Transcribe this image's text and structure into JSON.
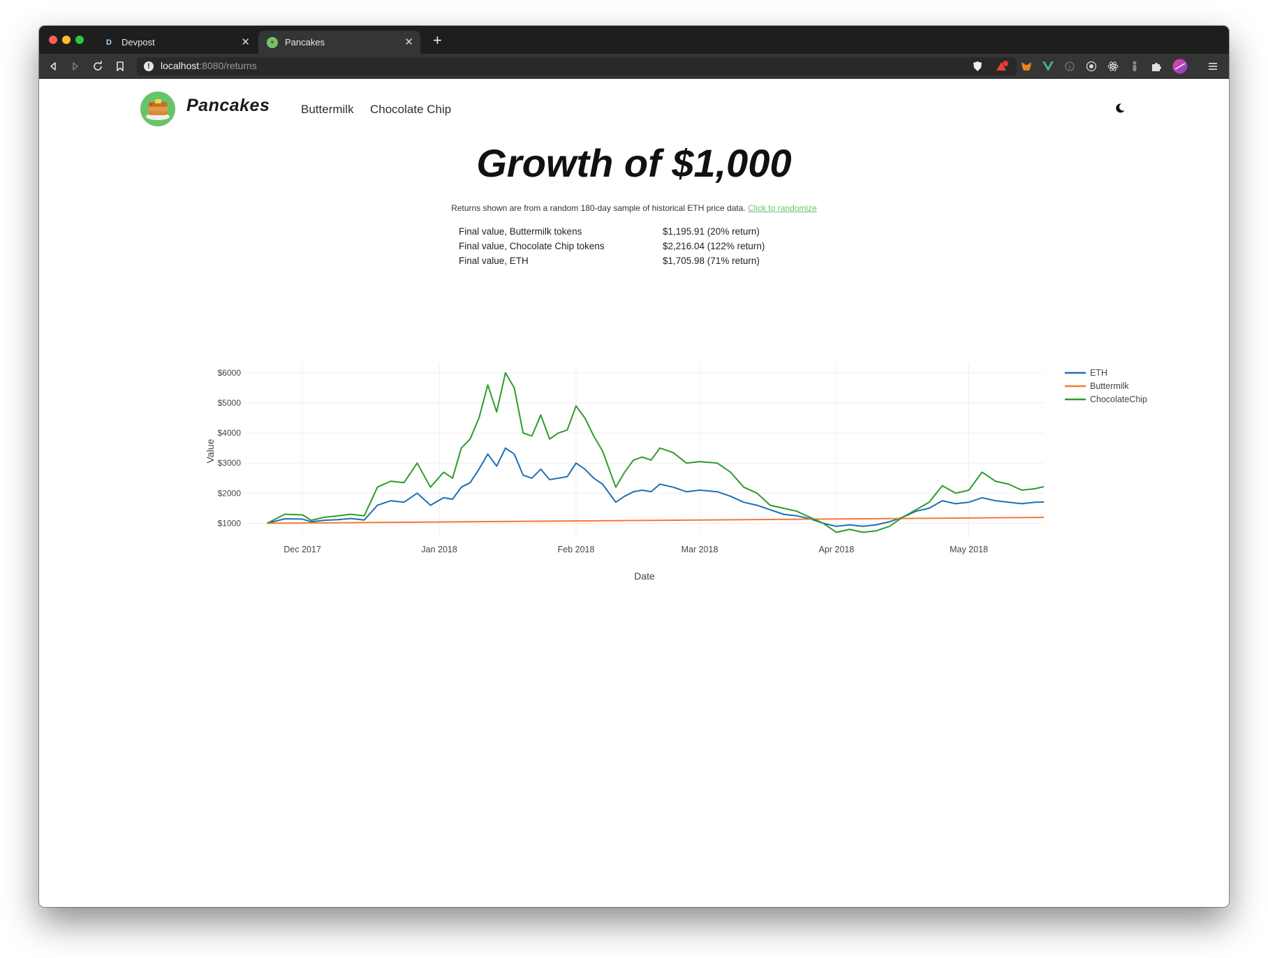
{
  "browser": {
    "tabs": [
      {
        "label": "Devpost",
        "favicon": "D",
        "active": false
      },
      {
        "label": "Pancakes",
        "favicon": "pancake-favicon",
        "active": true
      }
    ],
    "url": {
      "host": "localhost",
      "path": ":8080/returns"
    }
  },
  "nav": {
    "brand": "Pancakes",
    "links": [
      "Buttermilk",
      "Chocolate Chip"
    ]
  },
  "main": {
    "title": "Growth of $1,000",
    "subtitle": "Returns shown are from a random 180-day sample of historical ETH price data.",
    "randomize_link": "Click to randomize",
    "summary": [
      {
        "label": "Final value, Buttermilk tokens",
        "value": "$1,195.91 (20% return)"
      },
      {
        "label": "Final value, Chocolate Chip tokens",
        "value": "$2,216.04 (122% return)"
      },
      {
        "label": "Final value, ETH",
        "value": "$1,705.98 (71% return)"
      }
    ]
  },
  "colors": {
    "eth": "#1f6fb4",
    "buttermilk": "#f47a32",
    "chocolatechip": "#2c9c2c",
    "link": "#6cbf6c"
  },
  "chart_data": {
    "type": "line",
    "xlabel": "Date",
    "ylabel": "Value",
    "ylim": [
      500,
      6300
    ],
    "yticks": [
      1000,
      2000,
      3000,
      4000,
      5000,
      6000
    ],
    "yticklabels": [
      "$1000",
      "$2000",
      "$3000",
      "$4000",
      "$5000",
      "$6000"
    ],
    "xlim": [
      "2017-11-18",
      "2018-05-18"
    ],
    "xticks": [
      "2017-12-01",
      "2018-01-01",
      "2018-02-01",
      "2018-03-01",
      "2018-04-01",
      "2018-05-01"
    ],
    "xticklabels": [
      "Dec 2017",
      "Jan 2018",
      "Feb 2018",
      "Mar 2018",
      "Apr 2018",
      "May 2018"
    ],
    "grid": true,
    "legend_position": "right",
    "series": [
      {
        "name": "ETH",
        "points": [
          [
            "2017-11-23",
            1000
          ],
          [
            "2017-11-27",
            1150
          ],
          [
            "2017-12-01",
            1140
          ],
          [
            "2017-12-03",
            1050
          ],
          [
            "2017-12-06",
            1100
          ],
          [
            "2017-12-09",
            1120
          ],
          [
            "2017-12-12",
            1160
          ],
          [
            "2017-12-15",
            1110
          ],
          [
            "2017-12-18",
            1600
          ],
          [
            "2017-12-21",
            1750
          ],
          [
            "2017-12-24",
            1700
          ],
          [
            "2017-12-27",
            2000
          ],
          [
            "2017-12-30",
            1600
          ],
          [
            "2018-01-02",
            1850
          ],
          [
            "2018-01-04",
            1800
          ],
          [
            "2018-01-06",
            2200
          ],
          [
            "2018-01-08",
            2350
          ],
          [
            "2018-01-10",
            2800
          ],
          [
            "2018-01-12",
            3300
          ],
          [
            "2018-01-14",
            2900
          ],
          [
            "2018-01-16",
            3500
          ],
          [
            "2018-01-18",
            3300
          ],
          [
            "2018-01-20",
            2600
          ],
          [
            "2018-01-22",
            2500
          ],
          [
            "2018-01-24",
            2800
          ],
          [
            "2018-01-26",
            2450
          ],
          [
            "2018-01-28",
            2500
          ],
          [
            "2018-01-30",
            2550
          ],
          [
            "2018-02-01",
            3000
          ],
          [
            "2018-02-03",
            2800
          ],
          [
            "2018-02-05",
            2500
          ],
          [
            "2018-02-07",
            2300
          ],
          [
            "2018-02-10",
            1700
          ],
          [
            "2018-02-12",
            1900
          ],
          [
            "2018-02-14",
            2050
          ],
          [
            "2018-02-16",
            2100
          ],
          [
            "2018-02-18",
            2050
          ],
          [
            "2018-02-20",
            2300
          ],
          [
            "2018-02-23",
            2200
          ],
          [
            "2018-02-26",
            2050
          ],
          [
            "2018-03-01",
            2100
          ],
          [
            "2018-03-05",
            2050
          ],
          [
            "2018-03-08",
            1900
          ],
          [
            "2018-03-11",
            1700
          ],
          [
            "2018-03-14",
            1600
          ],
          [
            "2018-03-17",
            1450
          ],
          [
            "2018-03-20",
            1300
          ],
          [
            "2018-03-23",
            1250
          ],
          [
            "2018-03-26",
            1150
          ],
          [
            "2018-03-29",
            1000
          ],
          [
            "2018-04-01",
            900
          ],
          [
            "2018-04-04",
            950
          ],
          [
            "2018-04-07",
            900
          ],
          [
            "2018-04-10",
            950
          ],
          [
            "2018-04-13",
            1050
          ],
          [
            "2018-04-16",
            1200
          ],
          [
            "2018-04-19",
            1400
          ],
          [
            "2018-04-22",
            1500
          ],
          [
            "2018-04-25",
            1750
          ],
          [
            "2018-04-28",
            1650
          ],
          [
            "2018-05-01",
            1700
          ],
          [
            "2018-05-04",
            1850
          ],
          [
            "2018-05-07",
            1750
          ],
          [
            "2018-05-10",
            1700
          ],
          [
            "2018-05-13",
            1650
          ],
          [
            "2018-05-16",
            1700
          ],
          [
            "2018-05-18",
            1705.98
          ]
        ]
      },
      {
        "name": "Buttermilk",
        "points": [
          [
            "2017-11-23",
            1000
          ],
          [
            "2018-05-18",
            1195.91
          ]
        ]
      },
      {
        "name": "ChocolateChip",
        "points": [
          [
            "2017-11-23",
            1000
          ],
          [
            "2017-11-27",
            1300
          ],
          [
            "2017-12-01",
            1280
          ],
          [
            "2017-12-03",
            1100
          ],
          [
            "2017-12-06",
            1200
          ],
          [
            "2017-12-09",
            1250
          ],
          [
            "2017-12-12",
            1300
          ],
          [
            "2017-12-15",
            1250
          ],
          [
            "2017-12-18",
            2200
          ],
          [
            "2017-12-21",
            2400
          ],
          [
            "2017-12-24",
            2350
          ],
          [
            "2017-12-27",
            3000
          ],
          [
            "2017-12-30",
            2200
          ],
          [
            "2018-01-02",
            2700
          ],
          [
            "2018-01-04",
            2500
          ],
          [
            "2018-01-06",
            3500
          ],
          [
            "2018-01-08",
            3800
          ],
          [
            "2018-01-10",
            4500
          ],
          [
            "2018-01-12",
            5600
          ],
          [
            "2018-01-14",
            4700
          ],
          [
            "2018-01-16",
            6000
          ],
          [
            "2018-01-18",
            5500
          ],
          [
            "2018-01-20",
            4000
          ],
          [
            "2018-01-22",
            3900
          ],
          [
            "2018-01-24",
            4600
          ],
          [
            "2018-01-26",
            3800
          ],
          [
            "2018-01-28",
            4000
          ],
          [
            "2018-01-30",
            4100
          ],
          [
            "2018-02-01",
            4900
          ],
          [
            "2018-02-03",
            4500
          ],
          [
            "2018-02-05",
            3900
          ],
          [
            "2018-02-07",
            3400
          ],
          [
            "2018-02-10",
            2200
          ],
          [
            "2018-02-12",
            2700
          ],
          [
            "2018-02-14",
            3100
          ],
          [
            "2018-02-16",
            3200
          ],
          [
            "2018-02-18",
            3100
          ],
          [
            "2018-02-20",
            3500
          ],
          [
            "2018-02-23",
            3350
          ],
          [
            "2018-02-26",
            3000
          ],
          [
            "2018-03-01",
            3050
          ],
          [
            "2018-03-05",
            3000
          ],
          [
            "2018-03-08",
            2700
          ],
          [
            "2018-03-11",
            2200
          ],
          [
            "2018-03-14",
            2000
          ],
          [
            "2018-03-17",
            1600
          ],
          [
            "2018-03-20",
            1500
          ],
          [
            "2018-03-23",
            1400
          ],
          [
            "2018-03-26",
            1200
          ],
          [
            "2018-03-29",
            1000
          ],
          [
            "2018-04-01",
            700
          ],
          [
            "2018-04-04",
            800
          ],
          [
            "2018-04-07",
            700
          ],
          [
            "2018-04-10",
            750
          ],
          [
            "2018-04-13",
            900
          ],
          [
            "2018-04-16",
            1200
          ],
          [
            "2018-04-19",
            1450
          ],
          [
            "2018-04-22",
            1700
          ],
          [
            "2018-04-25",
            2250
          ],
          [
            "2018-04-28",
            2000
          ],
          [
            "2018-05-01",
            2100
          ],
          [
            "2018-05-04",
            2700
          ],
          [
            "2018-05-07",
            2400
          ],
          [
            "2018-05-10",
            2300
          ],
          [
            "2018-05-13",
            2100
          ],
          [
            "2018-05-16",
            2150
          ],
          [
            "2018-05-18",
            2216.04
          ]
        ]
      }
    ]
  }
}
